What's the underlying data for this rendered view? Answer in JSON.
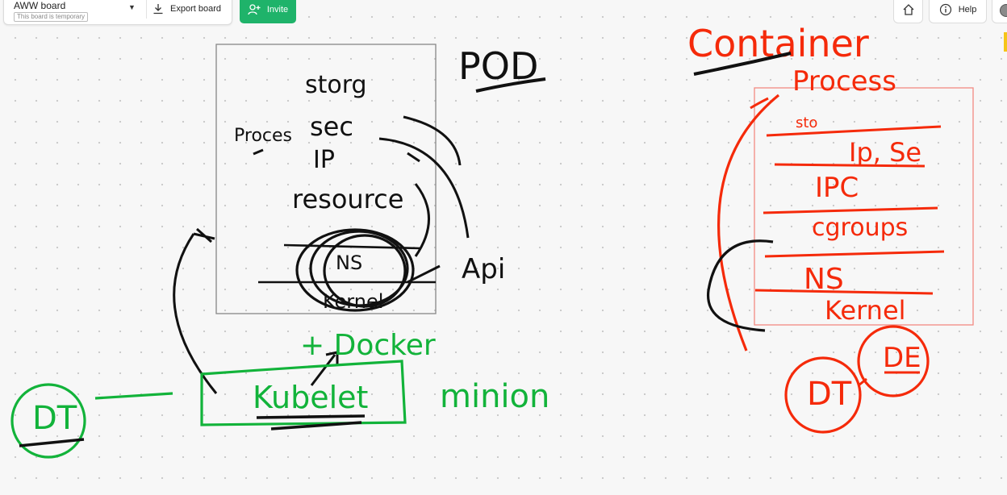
{
  "header": {
    "board_title": "AWW board",
    "board_subtitle": "This board is temporary",
    "export_label": "Export board",
    "invite_label": "Invite",
    "help_label": "Help"
  },
  "icons": {
    "caret": "chevron-down-icon",
    "export": "download-icon",
    "invite": "add-user-icon",
    "home": "home-icon",
    "help": "info-icon",
    "avatar": "user-avatar"
  },
  "colors": {
    "ink_black": "#111111",
    "ink_green": "#12b33a",
    "ink_red": "#f52a0a",
    "invite_green": "#1fb36a",
    "frame_red": "#f28b82"
  },
  "whiteboard": {
    "pod_label": "POD",
    "pod_items": [
      "storg",
      "sec",
      "IP",
      "resource"
    ],
    "process_label": "Proces",
    "ns_label": "NS",
    "kernel_label": "Kernel",
    "api_label": "Api",
    "docker_label": "+ Docker",
    "kubelet_label": "Kubelet",
    "minion_label": "minion",
    "dt_left_label": "DT",
    "container_label": "Container",
    "container_layers": [
      "Process",
      "sto",
      "Ip, Se",
      "IPC",
      "cgroups",
      "NS",
      "Kernel"
    ],
    "dt_right_label": "DT",
    "de_label": "DE"
  }
}
